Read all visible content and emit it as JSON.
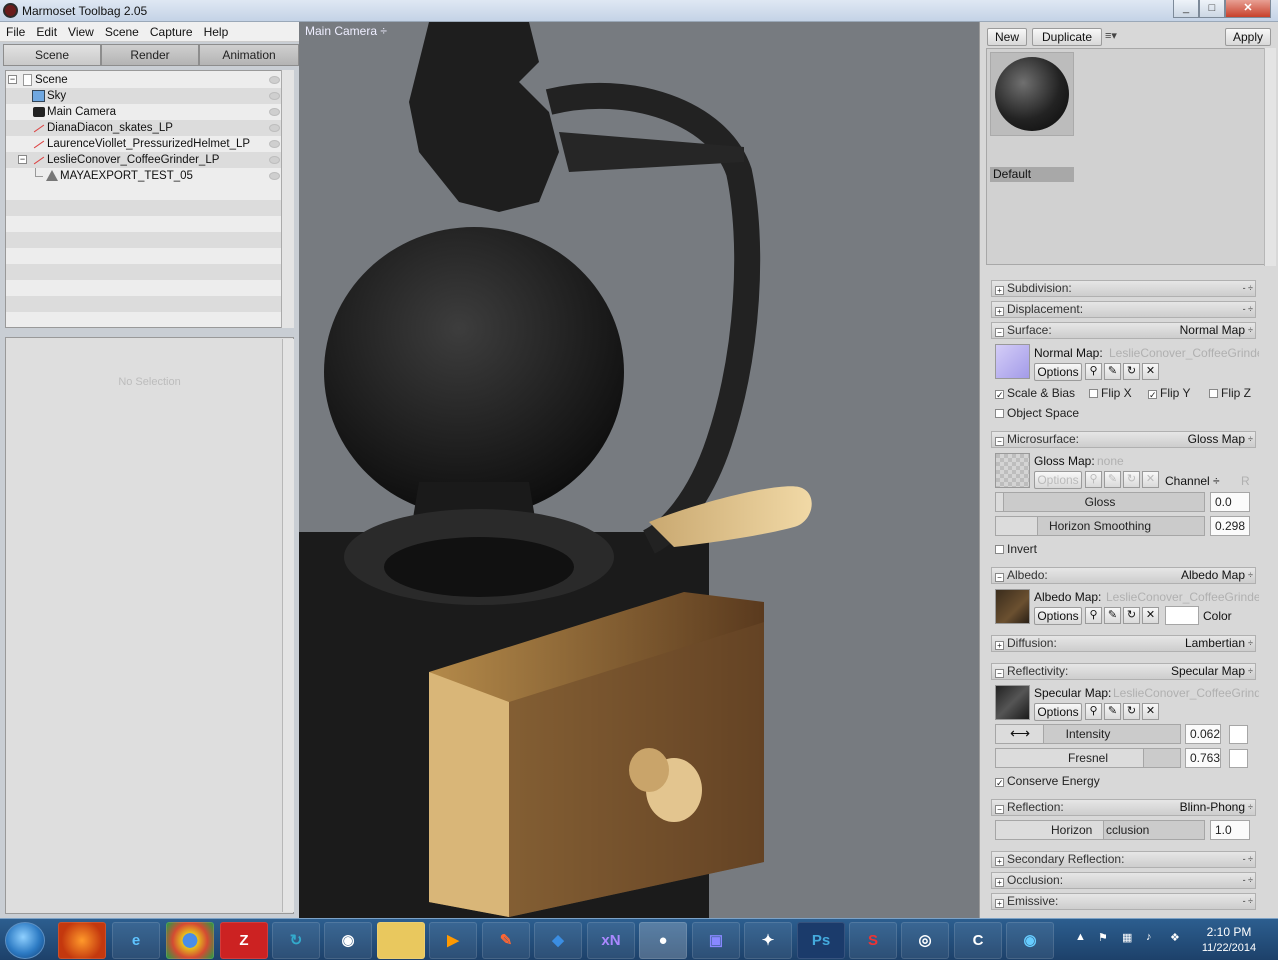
{
  "window": {
    "title": "Marmoset Toolbag 2.05",
    "btn_min": "_",
    "btn_max": "□",
    "btn_close": "✕"
  },
  "menu": [
    "File",
    "Edit",
    "View",
    "Scene",
    "Capture",
    "Help"
  ],
  "tabs": [
    "Scene",
    "Render",
    "Animation"
  ],
  "tree": [
    {
      "label": "Scene",
      "icon": "scene-icon"
    },
    {
      "label": "Sky",
      "icon": "sky-icon"
    },
    {
      "label": "Main Camera",
      "icon": "camera-icon"
    },
    {
      "label": "DianaDiacon_skates_LP",
      "icon": "mesh-icon"
    },
    {
      "label": "LaurenceViollet_PressurizedHelmet_LP",
      "icon": "mesh-icon"
    },
    {
      "label": "LeslieConover_CoffeeGrinder_LP",
      "icon": "mesh-icon"
    },
    {
      "label": "MAYAEXPORT_TEST_05",
      "icon": "submesh-icon"
    }
  ],
  "properties": {
    "empty": "No Selection"
  },
  "viewport": {
    "camera": "Main Camera ÷"
  },
  "toolbar": {
    "new": "New",
    "duplicate": "Duplicate",
    "menu": "≡▾",
    "apply": "Apply"
  },
  "material": {
    "name": "Default"
  },
  "sections": {
    "subdivision": {
      "label": "Subdivision:",
      "spin": "- ÷"
    },
    "displacement": {
      "label": "Displacement:",
      "spin": "- ÷"
    },
    "surface": {
      "label": "Surface:",
      "value": "Normal Map",
      "spin": "÷"
    },
    "microsurface": {
      "label": "Microsurface:",
      "value": "Gloss Map",
      "spin": "÷"
    },
    "albedo": {
      "label": "Albedo:",
      "value": "Albedo Map",
      "spin": "÷"
    },
    "diffusion": {
      "label": "Diffusion:",
      "value": "Lambertian",
      "spin": "÷"
    },
    "reflectivity": {
      "label": "Reflectivity:",
      "value": "Specular Map",
      "spin": "÷"
    },
    "reflection": {
      "label": "Reflection:",
      "value": "Blinn-Phong",
      "spin": "÷"
    },
    "secondary": {
      "label": "Secondary Reflection:",
      "spin": "- ÷"
    },
    "occlusion": {
      "label": "Occlusion:",
      "spin": "- ÷"
    },
    "emissive": {
      "label": "Emissive:",
      "spin": "- ÷"
    }
  },
  "surface": {
    "map_label": "Normal Map:",
    "map_value": "LeslieConover_CoffeeGrinder",
    "options": "Options",
    "scale_bias": "Scale & Bias",
    "flip_x": "Flip X",
    "flip_y": "Flip Y",
    "flip_z": "Flip Z",
    "object_space": "Object Space"
  },
  "microsurface": {
    "map_label": "Gloss Map:",
    "map_value": "none",
    "options": "Options",
    "channel_label": "Channel ÷",
    "channel_value": "R",
    "gloss_label": "Gloss",
    "gloss_value": "0.0",
    "horizon_label": "Horizon Smoothing",
    "horizon_value": "0.298",
    "invert": "Invert"
  },
  "albedo": {
    "map_label": "Albedo Map:",
    "map_value": "LeslieConover_CoffeeGrinder",
    "options": "Options",
    "color": "Color"
  },
  "reflectivity": {
    "map_label": "Specular Map:",
    "map_value": "LeslieConover_CoffeeGrinder",
    "options": "Options",
    "intensity_label": "Intensity",
    "intensity_value": "0.062",
    "fresnel_label": "Fresnel",
    "fresnel_value": "0.763",
    "conserve": "Conserve Energy"
  },
  "reflection": {
    "horizon_label": "Horizon",
    "horizon_label2": "cclusion",
    "horizon_value": "1.0"
  },
  "taskbar": {
    "apps": [
      "Firefox",
      "Internet Explorer",
      "Chrome",
      "FileZilla",
      "Sync",
      "Steam",
      "Explorer",
      "Media Player",
      "Paint",
      "Dropbox",
      "xN",
      "Marmoset",
      "Modo",
      "ZBrush",
      "Photoshop",
      "Substance",
      "Unity",
      "Cinema",
      "Camera"
    ],
    "time": "2:10 PM",
    "date": "11/22/2014"
  }
}
